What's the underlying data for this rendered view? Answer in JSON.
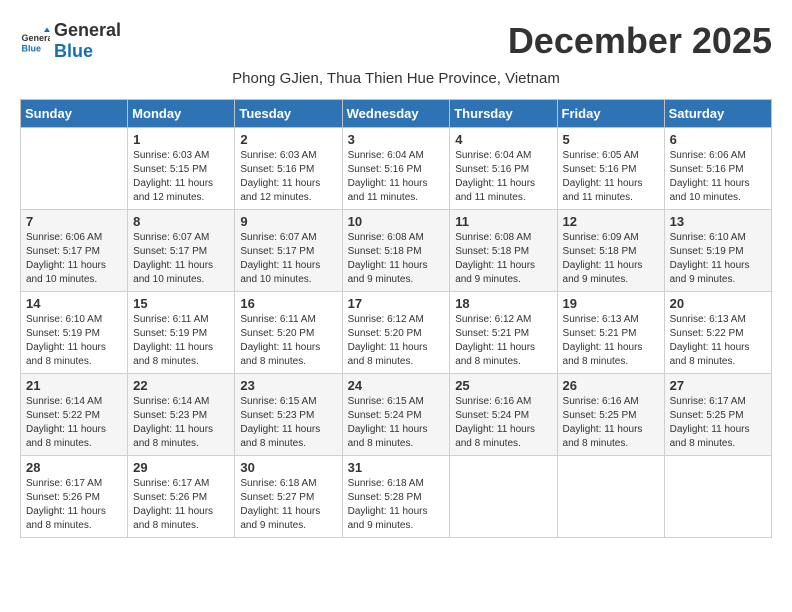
{
  "logo": {
    "general": "General",
    "blue": "Blue"
  },
  "title": "December 2025",
  "subtitle": "Phong GJien, Thua Thien Hue Province, Vietnam",
  "days_of_week": [
    "Sunday",
    "Monday",
    "Tuesday",
    "Wednesday",
    "Thursday",
    "Friday",
    "Saturday"
  ],
  "weeks": [
    [
      {
        "day": "",
        "detail": ""
      },
      {
        "day": "1",
        "detail": "Sunrise: 6:03 AM\nSunset: 5:15 PM\nDaylight: 11 hours\nand 12 minutes."
      },
      {
        "day": "2",
        "detail": "Sunrise: 6:03 AM\nSunset: 5:16 PM\nDaylight: 11 hours\nand 12 minutes."
      },
      {
        "day": "3",
        "detail": "Sunrise: 6:04 AM\nSunset: 5:16 PM\nDaylight: 11 hours\nand 11 minutes."
      },
      {
        "day": "4",
        "detail": "Sunrise: 6:04 AM\nSunset: 5:16 PM\nDaylight: 11 hours\nand 11 minutes."
      },
      {
        "day": "5",
        "detail": "Sunrise: 6:05 AM\nSunset: 5:16 PM\nDaylight: 11 hours\nand 11 minutes."
      },
      {
        "day": "6",
        "detail": "Sunrise: 6:06 AM\nSunset: 5:16 PM\nDaylight: 11 hours\nand 10 minutes."
      }
    ],
    [
      {
        "day": "7",
        "detail": "Sunrise: 6:06 AM\nSunset: 5:17 PM\nDaylight: 11 hours\nand 10 minutes."
      },
      {
        "day": "8",
        "detail": "Sunrise: 6:07 AM\nSunset: 5:17 PM\nDaylight: 11 hours\nand 10 minutes."
      },
      {
        "day": "9",
        "detail": "Sunrise: 6:07 AM\nSunset: 5:17 PM\nDaylight: 11 hours\nand 10 minutes."
      },
      {
        "day": "10",
        "detail": "Sunrise: 6:08 AM\nSunset: 5:18 PM\nDaylight: 11 hours\nand 9 minutes."
      },
      {
        "day": "11",
        "detail": "Sunrise: 6:08 AM\nSunset: 5:18 PM\nDaylight: 11 hours\nand 9 minutes."
      },
      {
        "day": "12",
        "detail": "Sunrise: 6:09 AM\nSunset: 5:18 PM\nDaylight: 11 hours\nand 9 minutes."
      },
      {
        "day": "13",
        "detail": "Sunrise: 6:10 AM\nSunset: 5:19 PM\nDaylight: 11 hours\nand 9 minutes."
      }
    ],
    [
      {
        "day": "14",
        "detail": "Sunrise: 6:10 AM\nSunset: 5:19 PM\nDaylight: 11 hours\nand 8 minutes."
      },
      {
        "day": "15",
        "detail": "Sunrise: 6:11 AM\nSunset: 5:19 PM\nDaylight: 11 hours\nand 8 minutes."
      },
      {
        "day": "16",
        "detail": "Sunrise: 6:11 AM\nSunset: 5:20 PM\nDaylight: 11 hours\nand 8 minutes."
      },
      {
        "day": "17",
        "detail": "Sunrise: 6:12 AM\nSunset: 5:20 PM\nDaylight: 11 hours\nand 8 minutes."
      },
      {
        "day": "18",
        "detail": "Sunrise: 6:12 AM\nSunset: 5:21 PM\nDaylight: 11 hours\nand 8 minutes."
      },
      {
        "day": "19",
        "detail": "Sunrise: 6:13 AM\nSunset: 5:21 PM\nDaylight: 11 hours\nand 8 minutes."
      },
      {
        "day": "20",
        "detail": "Sunrise: 6:13 AM\nSunset: 5:22 PM\nDaylight: 11 hours\nand 8 minutes."
      }
    ],
    [
      {
        "day": "21",
        "detail": "Sunrise: 6:14 AM\nSunset: 5:22 PM\nDaylight: 11 hours\nand 8 minutes."
      },
      {
        "day": "22",
        "detail": "Sunrise: 6:14 AM\nSunset: 5:23 PM\nDaylight: 11 hours\nand 8 minutes."
      },
      {
        "day": "23",
        "detail": "Sunrise: 6:15 AM\nSunset: 5:23 PM\nDaylight: 11 hours\nand 8 minutes."
      },
      {
        "day": "24",
        "detail": "Sunrise: 6:15 AM\nSunset: 5:24 PM\nDaylight: 11 hours\nand 8 minutes."
      },
      {
        "day": "25",
        "detail": "Sunrise: 6:16 AM\nSunset: 5:24 PM\nDaylight: 11 hours\nand 8 minutes."
      },
      {
        "day": "26",
        "detail": "Sunrise: 6:16 AM\nSunset: 5:25 PM\nDaylight: 11 hours\nand 8 minutes."
      },
      {
        "day": "27",
        "detail": "Sunrise: 6:17 AM\nSunset: 5:25 PM\nDaylight: 11 hours\nand 8 minutes."
      }
    ],
    [
      {
        "day": "28",
        "detail": "Sunrise: 6:17 AM\nSunset: 5:26 PM\nDaylight: 11 hours\nand 8 minutes."
      },
      {
        "day": "29",
        "detail": "Sunrise: 6:17 AM\nSunset: 5:26 PM\nDaylight: 11 hours\nand 8 minutes."
      },
      {
        "day": "30",
        "detail": "Sunrise: 6:18 AM\nSunset: 5:27 PM\nDaylight: 11 hours\nand 9 minutes."
      },
      {
        "day": "31",
        "detail": "Sunrise: 6:18 AM\nSunset: 5:28 PM\nDaylight: 11 hours\nand 9 minutes."
      },
      {
        "day": "",
        "detail": ""
      },
      {
        "day": "",
        "detail": ""
      },
      {
        "day": "",
        "detail": ""
      }
    ]
  ]
}
